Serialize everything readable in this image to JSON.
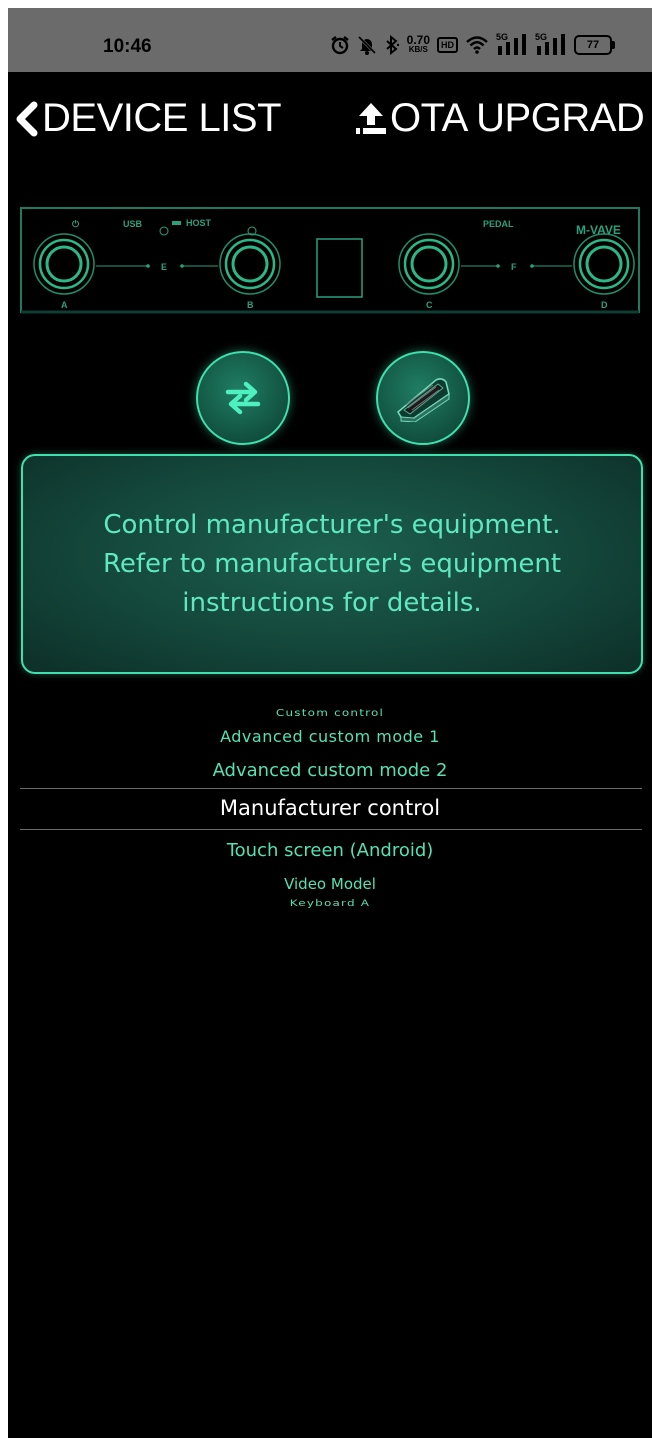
{
  "status_bar": {
    "time": "10:46",
    "net_speed": "0.70",
    "net_speed_unit": "KB/S",
    "hd_badge": "HD",
    "sim1": "5G",
    "sim2": "5G",
    "battery": "77",
    "icons": [
      "alarm-icon",
      "mute-icon",
      "bluetooth-icon",
      "wifi-icon",
      "signal-icon",
      "signal-icon",
      "battery-icon"
    ]
  },
  "nav": {
    "back_label": "DEVICE LIST",
    "ota_label": "OTA UPGRAD"
  },
  "device": {
    "labels": {
      "power": "⏻",
      "usb": "USB",
      "host": "HOST",
      "pedal": "PEDAL",
      "brand": "M-VAVE",
      "a": "A",
      "b": "B",
      "c": "C",
      "d": "D",
      "e": "E",
      "f": "F"
    }
  },
  "info_card": {
    "line1": "Control manufacturer's equipment.",
    "line2": "Refer to manufacturer's equipment",
    "line3": "instructions for details."
  },
  "mode_list": {
    "items": [
      "Custom control",
      "Advanced custom mode 1",
      "Advanced custom mode 2",
      "Manufacturer control",
      "Touch screen (Android)",
      "Video Model",
      "Keyboard A"
    ],
    "selected": "Manufacturer control"
  },
  "colors": {
    "accent": "#3ee0ad",
    "text_accent": "#5fe8bf",
    "background": "#000000",
    "status_bar": "#6b6b6b"
  }
}
